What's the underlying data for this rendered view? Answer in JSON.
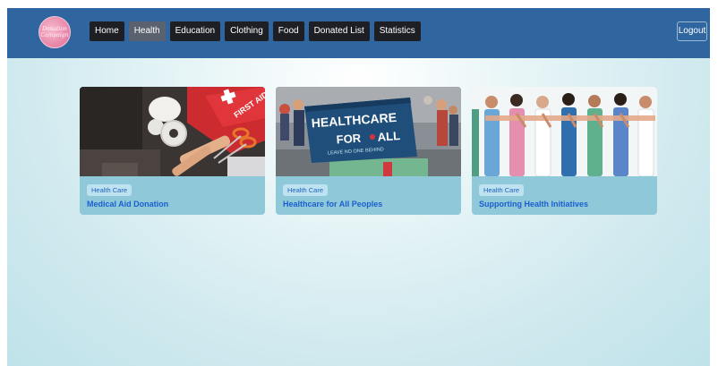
{
  "logo": {
    "text": "Donation Campaign"
  },
  "nav": {
    "items": [
      {
        "label": "Home"
      },
      {
        "label": "Health"
      },
      {
        "label": "Education"
      },
      {
        "label": "Clothing"
      },
      {
        "label": "Food"
      },
      {
        "label": "Donated List"
      },
      {
        "label": "Statistics"
      }
    ],
    "active": "Health",
    "logout": "Logout"
  },
  "cards": [
    {
      "category": "Health Care",
      "title": "Medical Aid Donation",
      "image_text": "FIRST AID"
    },
    {
      "category": "Health Care",
      "title": "Healthcare for All Peoples",
      "banner_line1": "HEALTHCARE",
      "banner_line2": "FOR",
      "banner_line3": "ALL",
      "banner_sub": "LEAVE NO ONE BEHIND"
    },
    {
      "category": "Health Care",
      "title": "Supporting Health Initiatives"
    }
  ],
  "colors": {
    "navbar": "#2f66a0",
    "card": "#8fc8d8",
    "badge_bg": "#bfe2f0",
    "accent_text": "#1a5fd0"
  }
}
